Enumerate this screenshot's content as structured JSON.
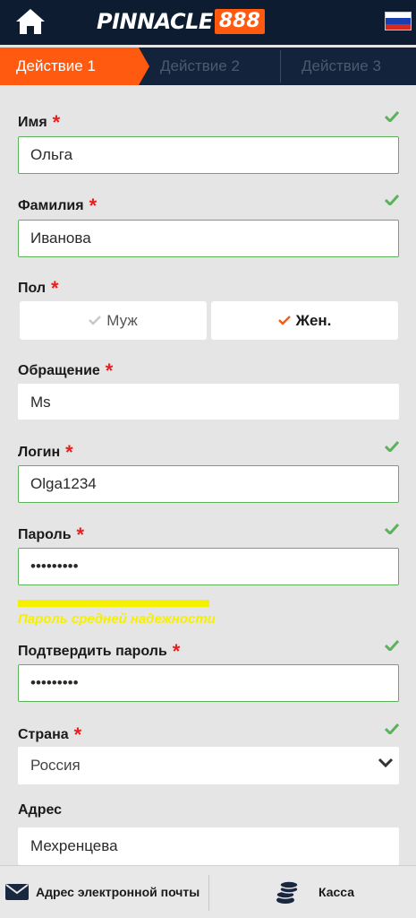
{
  "header": {
    "logo_text": "PINNACLE",
    "logo_number": "888",
    "flag": "russia-flag",
    "colors": {
      "bar": "#0d1c30",
      "accent": "#ff5a10"
    }
  },
  "steps": [
    {
      "label": "Действие 1",
      "active": true
    },
    {
      "label": "Действие 2",
      "active": false
    },
    {
      "label": "Действие 3",
      "active": false
    }
  ],
  "form": {
    "first_name": {
      "label": "Имя",
      "required": "*",
      "value": "Ольга"
    },
    "last_name": {
      "label": "Фамилия",
      "required": "*",
      "value": "Иванова"
    },
    "gender": {
      "label": "Пол",
      "required": "*",
      "options": [
        "Муж",
        "Жен."
      ],
      "selected": "Жен."
    },
    "salutation": {
      "label": "Обращение",
      "required": "*",
      "value": "Ms"
    },
    "login": {
      "label": "Логин",
      "required": "*",
      "value": "Olga1234"
    },
    "password": {
      "label": "Пароль",
      "required": "*",
      "value": "•••••••••",
      "strength_text": "Пароль средней надежности",
      "strength_fraction": 0.5
    },
    "confirm_password": {
      "label": "Подтвердить пароль",
      "required": "*",
      "value": "•••••••••"
    },
    "country": {
      "label": "Страна",
      "required": "*",
      "value": "Россия"
    },
    "address": {
      "label": "Адрес",
      "value": "Мехренцева"
    }
  },
  "bottom_bar": {
    "email_label": "Адрес электронной почты",
    "cashier_label": "Касса"
  },
  "status_colors": {
    "valid": "#5bb25b",
    "required": "#e81e1e",
    "strength": "#f5f000"
  }
}
